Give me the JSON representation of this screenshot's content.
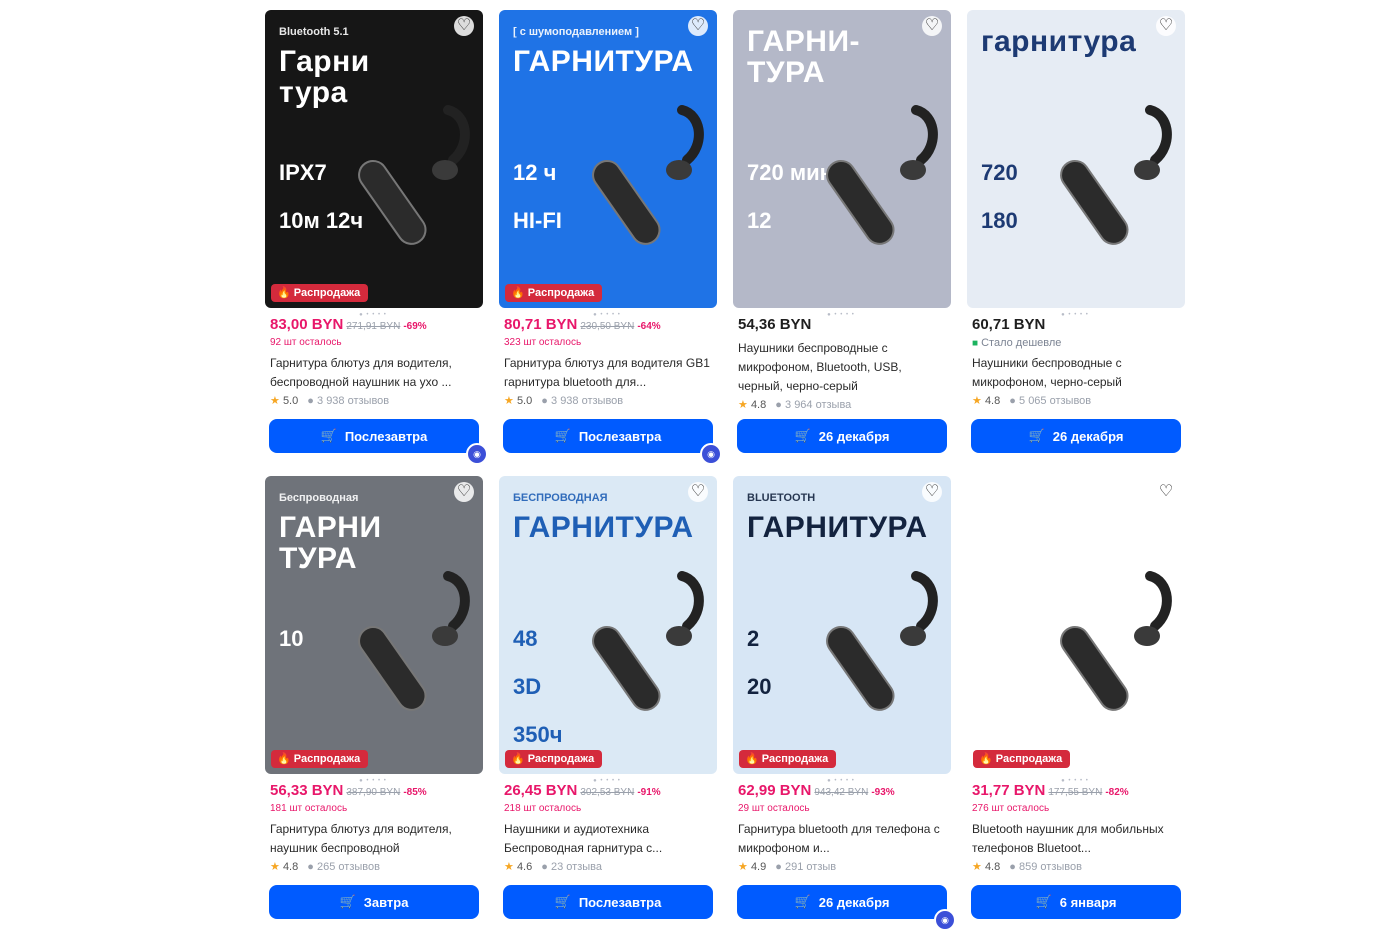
{
  "products": [
    {
      "img_title": "Гарни тура",
      "img_sub": "Bluetooth 5.1",
      "img_specs": [
        "IPX7",
        "10м  12ч"
      ],
      "bg": "#161616",
      "fg": "#ffffff",
      "sale_badge": "Распродажа",
      "price": "83,00 BYN",
      "old_price": "271,91 BYN",
      "discount": "-69%",
      "stock": "92 шт осталось",
      "cheaper": "",
      "name": "Гарнитура блютуз для водителя, беспроводной наушник на ухо ...",
      "rating": "5.0",
      "reviews": "3 938 отзывов",
      "delivery": "Послезавтра",
      "badge": true
    },
    {
      "img_title": "ГАРНИТУРА",
      "img_sub": "[ с шумоподавлением ]",
      "img_specs": [
        "12 ч",
        "HI-FI"
      ],
      "bg": "#1f73e6",
      "fg": "#ffffff",
      "sale_badge": "Распродажа",
      "price": "80,71 BYN",
      "old_price": "230,50 BYN",
      "discount": "-64%",
      "stock": "323 шт осталось",
      "cheaper": "",
      "name": "Гарнитура блютуз для водителя GB1 гарнитура bluetooth для...",
      "rating": "5.0",
      "reviews": "3 938 отзывов",
      "delivery": "Послезавтра",
      "badge": true
    },
    {
      "img_title": "ГАРНИ- ТУРА",
      "img_sub": "",
      "img_specs": [
        "720 мин",
        "12"
      ],
      "bg": "#b4b8c8",
      "fg": "#ffffff",
      "sale_badge": "",
      "price": "54,36 BYN",
      "old_price": "",
      "discount": "",
      "stock": "",
      "cheaper": "",
      "name": "Наушники беспроводные с микрофоном, Bluetooth, USB, черный, черно-серый",
      "rating": "4.8",
      "reviews": "3 964 отзыва",
      "delivery": "26 декабря",
      "badge": false
    },
    {
      "img_title": "гарнитура",
      "img_sub": "",
      "img_specs": [
        "720",
        "180"
      ],
      "bg": "#e6ecf4",
      "fg": "#1d3a73",
      "sale_badge": "",
      "price": "60,71 BYN",
      "old_price": "",
      "discount": "",
      "stock": "",
      "cheaper": "Стало дешевле",
      "name": "Наушники беспроводные с микрофоном, черно-серый",
      "rating": "4.8",
      "reviews": "5 065 отзывов",
      "delivery": "26 декабря",
      "badge": false
    },
    {
      "img_title": "ГАРНИ ТУРА",
      "img_sub": "Беспроводная",
      "img_specs": [
        "10"
      ],
      "bg": "#6f737a",
      "fg": "#ffffff",
      "sale_badge": "Распродажа",
      "price": "56,33 BYN",
      "old_price": "387,90 BYN",
      "discount": "-85%",
      "stock": "181 шт осталось",
      "cheaper": "",
      "name": "Гарнитура блютуз для водителя, наушник беспроводной",
      "rating": "4.8",
      "reviews": "265 отзывов",
      "delivery": "Завтра",
      "badge": false
    },
    {
      "img_title": "ГАРНИТУРА",
      "img_sub": "БЕСПРОВОДНАЯ",
      "img_specs": [
        "48",
        "3D",
        "350ч"
      ],
      "bg": "#dbe9f5",
      "fg": "#1f5fb5",
      "sale_badge": "Распродажа",
      "price": "26,45 BYN",
      "old_price": "302,53 BYN",
      "discount": "-91%",
      "stock": "218 шт осталось",
      "cheaper": "",
      "name": "Наушники и аудиотехника Беспроводная гарнитура с...",
      "rating": "4.6",
      "reviews": "23 отзыва",
      "delivery": "Послезавтра",
      "badge": false
    },
    {
      "img_title": "ГАРНИТУРА",
      "img_sub": "BLUETOOTH",
      "img_specs": [
        "2",
        "20"
      ],
      "bg": "#d7e6f5",
      "fg": "#13233f",
      "sale_badge": "Распродажа",
      "price": "62,99 BYN",
      "old_price": "943,42 BYN",
      "discount": "-93%",
      "stock": "29 шт осталось",
      "cheaper": "",
      "name": "Гарнитура bluetooth для телефона с микрофоном и...",
      "rating": "4.9",
      "reviews": "291 отзыв",
      "delivery": "26 декабря",
      "badge": true
    },
    {
      "img_title": "",
      "img_sub": "",
      "img_specs": [],
      "bg": "#ffffff",
      "fg": "#111111",
      "sale_badge": "Распродажа",
      "price": "31,77 BYN",
      "old_price": "177,55 BYN",
      "discount": "-82%",
      "stock": "276 шт осталось",
      "cheaper": "",
      "name": "Bluetooth наушник для мобильных телефонов Bluetoot...",
      "rating": "4.8",
      "reviews": "859 отзывов",
      "delivery": "6 января",
      "badge": false
    }
  ]
}
